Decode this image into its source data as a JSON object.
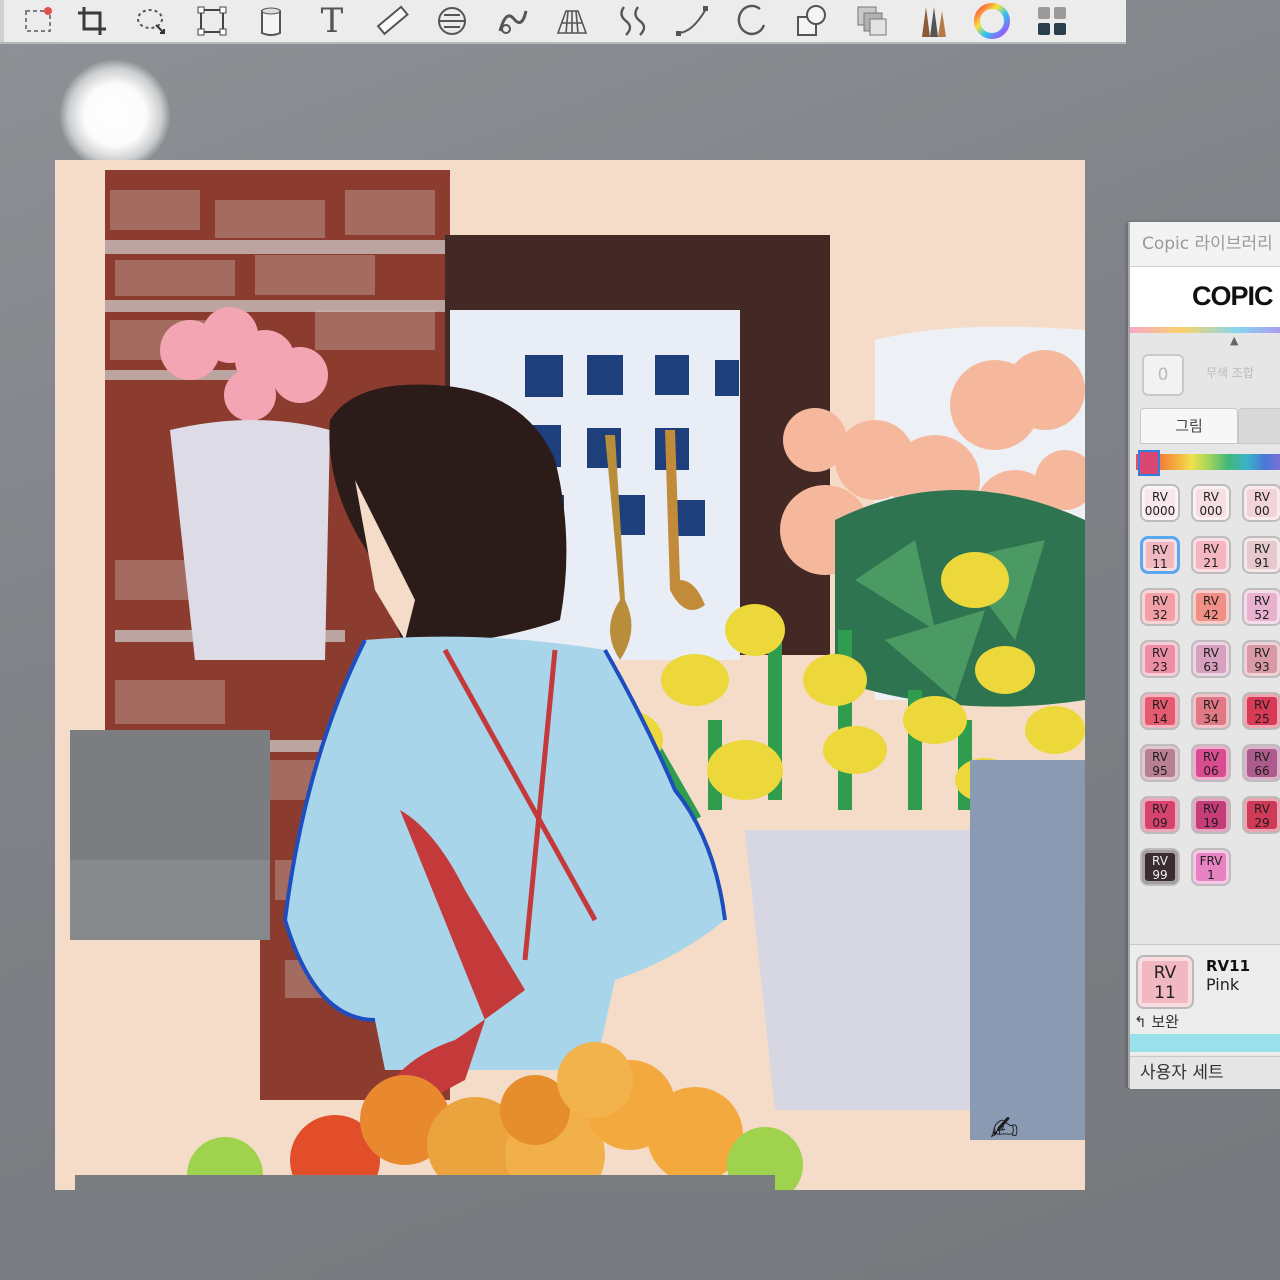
{
  "toolbar": {
    "tools": [
      "marquee-select-icon",
      "crop-icon",
      "lasso-icon",
      "transform-icon",
      "bucket-icon",
      "text-icon",
      "ruler-icon",
      "symmetry-icon",
      "warp-icon",
      "perspective-grid-icon",
      "distort-icon",
      "curve-icon",
      "ellipse-icon",
      "shape-icon",
      "layers-icon",
      "brush-library-icon",
      "color-wheel-icon",
      "swatch-set-icon"
    ],
    "text_tool_glyph": "T"
  },
  "copic_panel": {
    "title": "Copic 라이브러리",
    "logo": "COPIC",
    "zero_chip": "0",
    "zero_label": "무색 조합",
    "tab_label": "그림",
    "swatches": [
      {
        "code": "RV",
        "num": "0000",
        "color": "#f7e6ea"
      },
      {
        "code": "RV",
        "num": "000",
        "color": "#f6dfe3"
      },
      {
        "code": "RV",
        "num": "00",
        "color": "#f2d3d8"
      },
      {
        "code": "RV",
        "num": "11",
        "color": "#f2b8c1",
        "selected": true
      },
      {
        "code": "RV",
        "num": "21",
        "color": "#f4b7c2"
      },
      {
        "code": "RV",
        "num": "91",
        "color": "#e5c9cc"
      },
      {
        "code": "RV",
        "num": "32",
        "color": "#f2a0a6"
      },
      {
        "code": "RV",
        "num": "42",
        "color": "#ef8f86"
      },
      {
        "code": "RV",
        "num": "52",
        "color": "#e9b1d0"
      },
      {
        "code": "RV",
        "num": "23",
        "color": "#ed8ea6"
      },
      {
        "code": "RV",
        "num": "63",
        "color": "#d7a0bf"
      },
      {
        "code": "RV",
        "num": "93",
        "color": "#d99aa5"
      },
      {
        "code": "RV",
        "num": "14",
        "color": "#e45a6f"
      },
      {
        "code": "RV",
        "num": "34",
        "color": "#e07885"
      },
      {
        "code": "RV",
        "num": "25",
        "color": "#d83a55"
      },
      {
        "code": "RV",
        "num": "95",
        "color": "#b98095"
      },
      {
        "code": "RV",
        "num": "06",
        "color": "#d94d90"
      },
      {
        "code": "RV",
        "num": "66",
        "color": "#ad5a8c"
      },
      {
        "code": "RV",
        "num": "09",
        "color": "#d6436e"
      },
      {
        "code": "RV",
        "num": "19",
        "color": "#c43d78"
      },
      {
        "code": "RV",
        "num": "29",
        "color": "#cf3a57"
      },
      {
        "code": "RV",
        "num": "99",
        "color": "#3a2c30"
      },
      {
        "code": "FRV",
        "num": "1",
        "color": "#e883c3"
      }
    ],
    "selected_code": "RV11",
    "selected_name": "Pink",
    "selected_chip_code": "RV",
    "selected_chip_num": "11",
    "complementary": "↰ 보완",
    "set_label": "사용자 세트"
  },
  "canvas": {
    "signature": "✍"
  }
}
